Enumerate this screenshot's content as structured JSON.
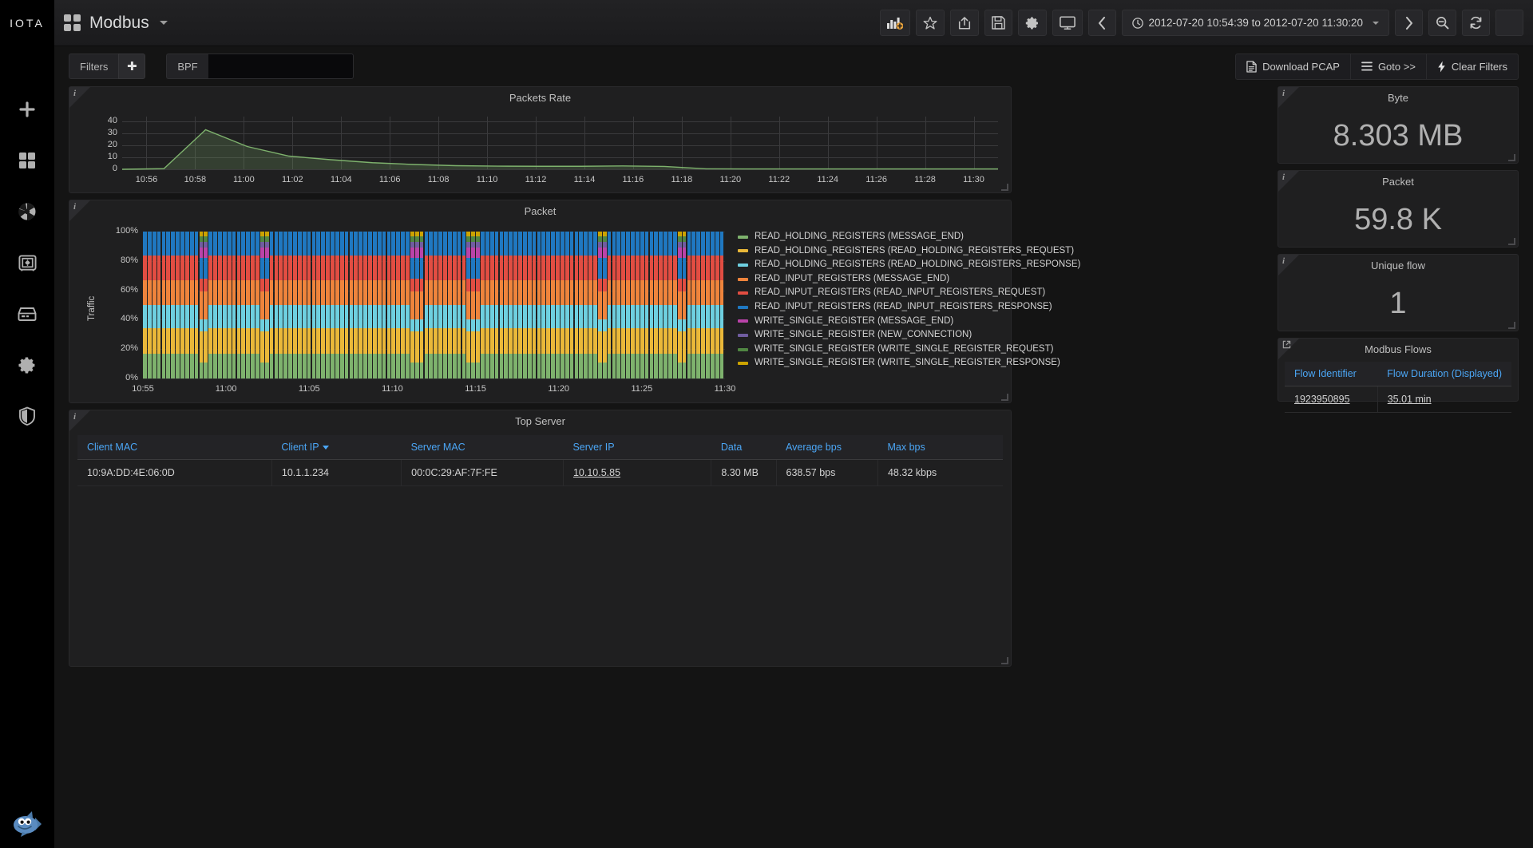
{
  "brand": {
    "logo": "IOTA"
  },
  "topnav": {
    "dashboard_title": "Modbus",
    "dashboard_icon": "dashboard-grid-icon",
    "buttons": [
      {
        "name": "add-panel-button",
        "icon": "bar-chart-plus-icon",
        "label": ""
      },
      {
        "name": "star-dashboard-button",
        "icon": "star-icon",
        "label": ""
      },
      {
        "name": "share-dashboard-button",
        "icon": "share-icon",
        "label": ""
      },
      {
        "name": "save-dashboard-button",
        "icon": "floppy-disk-icon",
        "label": ""
      },
      {
        "name": "dashboard-settings-button",
        "icon": "gear-icon",
        "label": ""
      },
      {
        "name": "tv-mode-button",
        "icon": "monitor-icon",
        "label": ""
      }
    ],
    "time_prev_label": "‹",
    "time_next_label": "›",
    "time_range": "2012-07-20 10:54:39 to 2012-07-20 11:30:20",
    "zoom_out_icon": "magnifier-minus-icon",
    "refresh_icon": "refresh-icon",
    "refresh_dropdown_icon": "chevron-down-icon"
  },
  "filterbar": {
    "filters_label": "Filters",
    "filters_add_label": "✚",
    "bpf_label": "BPF",
    "bpf_value": "",
    "bpf_placeholder": "",
    "actions": [
      {
        "name": "download-pcap-button",
        "icon": "file-icon",
        "label": "Download PCAP"
      },
      {
        "name": "goto-button",
        "icon": "hamburger-icon",
        "label": "Goto >>"
      },
      {
        "name": "clear-filters-button",
        "icon": "lightning-icon",
        "label": "Clear Filters"
      }
    ]
  },
  "sidebar": {
    "items": [
      {
        "name": "sidebar-item-add",
        "icon": "plus-icon"
      },
      {
        "name": "sidebar-item-dashboards",
        "icon": "grid-icon"
      },
      {
        "name": "sidebar-item-aperture",
        "icon": "aperture-icon"
      },
      {
        "name": "sidebar-item-vault",
        "icon": "safe-icon"
      },
      {
        "name": "sidebar-item-storage",
        "icon": "server-icon"
      },
      {
        "name": "sidebar-item-settings",
        "icon": "gear-icon"
      },
      {
        "name": "sidebar-item-security",
        "icon": "shield-icon"
      }
    ],
    "avatar_icon": "shark-avatar-icon"
  },
  "panels": {
    "packets_rate": {
      "title": "Packets Rate",
      "corner_glyph": "i"
    },
    "packet": {
      "title": "Packet",
      "corner_glyph": "i"
    },
    "top_server": {
      "title": "Top Server",
      "corner_glyph": "i"
    },
    "byte": {
      "title": "Byte",
      "value": "8.303 MB",
      "corner_glyph": "i"
    },
    "packet_stat": {
      "title": "Packet",
      "value": "59.8 K",
      "corner_glyph": "i"
    },
    "unique_flow": {
      "title": "Unique flow",
      "value": "1",
      "corner_glyph": "i"
    },
    "modbus_flows": {
      "title": "Modbus Flows",
      "corner_glyph": "↗"
    }
  },
  "top_server_table": {
    "columns": [
      "Client MAC",
      "Client IP",
      "Server MAC",
      "Server IP",
      "Data",
      "Average bps",
      "Max bps"
    ],
    "sorted_column": "Client IP",
    "rows": [
      {
        "client_mac": "10:9A:DD:4E:06:0D",
        "client_ip": "10.1.1.234",
        "server_mac": "00:0C:29:AF:7F:FE",
        "server_ip": "10.10.5.85",
        "data": "8.30 MB",
        "average_bps": "638.57 bps",
        "max_bps": "48.32 kbps"
      }
    ]
  },
  "modbus_flows_table": {
    "columns": [
      "Flow Identifier",
      "Flow Duration (Displayed)"
    ],
    "rows": [
      {
        "flow_identifier": "1923950895",
        "flow_duration": "35.01 min"
      }
    ]
  },
  "chart_data": [
    {
      "type": "area",
      "title": "Packets Rate",
      "xlabel": "",
      "ylabel": "",
      "ylim": [
        0,
        44
      ],
      "yticks": [
        0,
        10,
        20,
        30,
        40
      ],
      "xticks": [
        "10:56",
        "10:58",
        "11:00",
        "11:02",
        "11:04",
        "11:06",
        "11:08",
        "11:10",
        "11:12",
        "11:14",
        "11:16",
        "11:18",
        "11:20",
        "11:22",
        "11:24",
        "11:26",
        "11:28",
        "11:30"
      ],
      "grid": true,
      "legend_position": "none",
      "series": [
        {
          "name": "packets rate",
          "color": "#7EB26D",
          "x": [
            "10:54:39",
            "10:55:00",
            "10:55:10",
            "10:55:18",
            "10:55:25",
            "10:55:35",
            "10:55:50",
            "10:56:10",
            "10:56:40",
            "10:57:20",
            "10:58:00",
            "10:59:00",
            "11:00:00",
            "11:00:40",
            "11:01:00",
            "11:02:00",
            "11:05:00",
            "11:10:00",
            "11:15:00",
            "11:20:00",
            "11:25:00",
            "11:30:20"
          ],
          "values": [
            0,
            0.5,
            33,
            19,
            11,
            8,
            5.5,
            4,
            3,
            2.6,
            2.5,
            2.5,
            2.8,
            2.4,
            0.4,
            0.3,
            0.3,
            0.3,
            0.3,
            0.3,
            0.3,
            0.3
          ]
        }
      ]
    },
    {
      "type": "bar",
      "stacked": true,
      "percent": true,
      "title": "Packet",
      "xlabel": "",
      "ylabel": "Traffic",
      "ylim": [
        0,
        100
      ],
      "yticks": [
        "0%",
        "20%",
        "40%",
        "60%",
        "80%",
        "100%"
      ],
      "xticks": [
        "10:55",
        "11:00",
        "11:05",
        "11:10",
        "11:15",
        "11:20",
        "11:25",
        "11:30"
      ],
      "grid": true,
      "legend_position": "right",
      "series": [
        {
          "name": "READ_HOLDING_REGISTERS (MESSAGE_END)",
          "color": "#7EB26D",
          "typical_pct": 17
        },
        {
          "name": "READ_HOLDING_REGISTERS (READ_HOLDING_REGISTERS_REQUEST)",
          "color": "#EAB839",
          "typical_pct": 17
        },
        {
          "name": "READ_HOLDING_REGISTERS (READ_HOLDING_REGISTERS_RESPONSE)",
          "color": "#6ED0E0",
          "typical_pct": 16
        },
        {
          "name": "READ_INPUT_REGISTERS (MESSAGE_END)",
          "color": "#EF843C",
          "typical_pct": 17
        },
        {
          "name": "READ_INPUT_REGISTERS (READ_INPUT_REGISTERS_REQUEST)",
          "color": "#E24D42",
          "typical_pct": 17
        },
        {
          "name": "READ_INPUT_REGISTERS (READ_INPUT_REGISTERS_RESPONSE)",
          "color": "#1F78C1",
          "typical_pct": 16
        },
        {
          "name": "WRITE_SINGLE_REGISTER (MESSAGE_END)",
          "color": "#BA43A9",
          "typical_pct": 0
        },
        {
          "name": "WRITE_SINGLE_REGISTER (NEW_CONNECTION)",
          "color": "#705DA0",
          "typical_pct": 0
        },
        {
          "name": "WRITE_SINGLE_REGISTER (WRITE_SINGLE_REGISTER_REQUEST)",
          "color": "#508642",
          "typical_pct": 0
        },
        {
          "name": "WRITE_SINGLE_REGISTER (WRITE_SINGLE_REGISTER_RESPONSE)",
          "color": "#CCA300",
          "typical_pct": 0
        }
      ],
      "anomaly_bar_indices": [
        12,
        13,
        25,
        26,
        57,
        58,
        59,
        69,
        70,
        71,
        97,
        98,
        114,
        115
      ],
      "anomaly_distribution": [
        11,
        21,
        8,
        19,
        9,
        14,
        7,
        4,
        4,
        3
      ]
    }
  ]
}
